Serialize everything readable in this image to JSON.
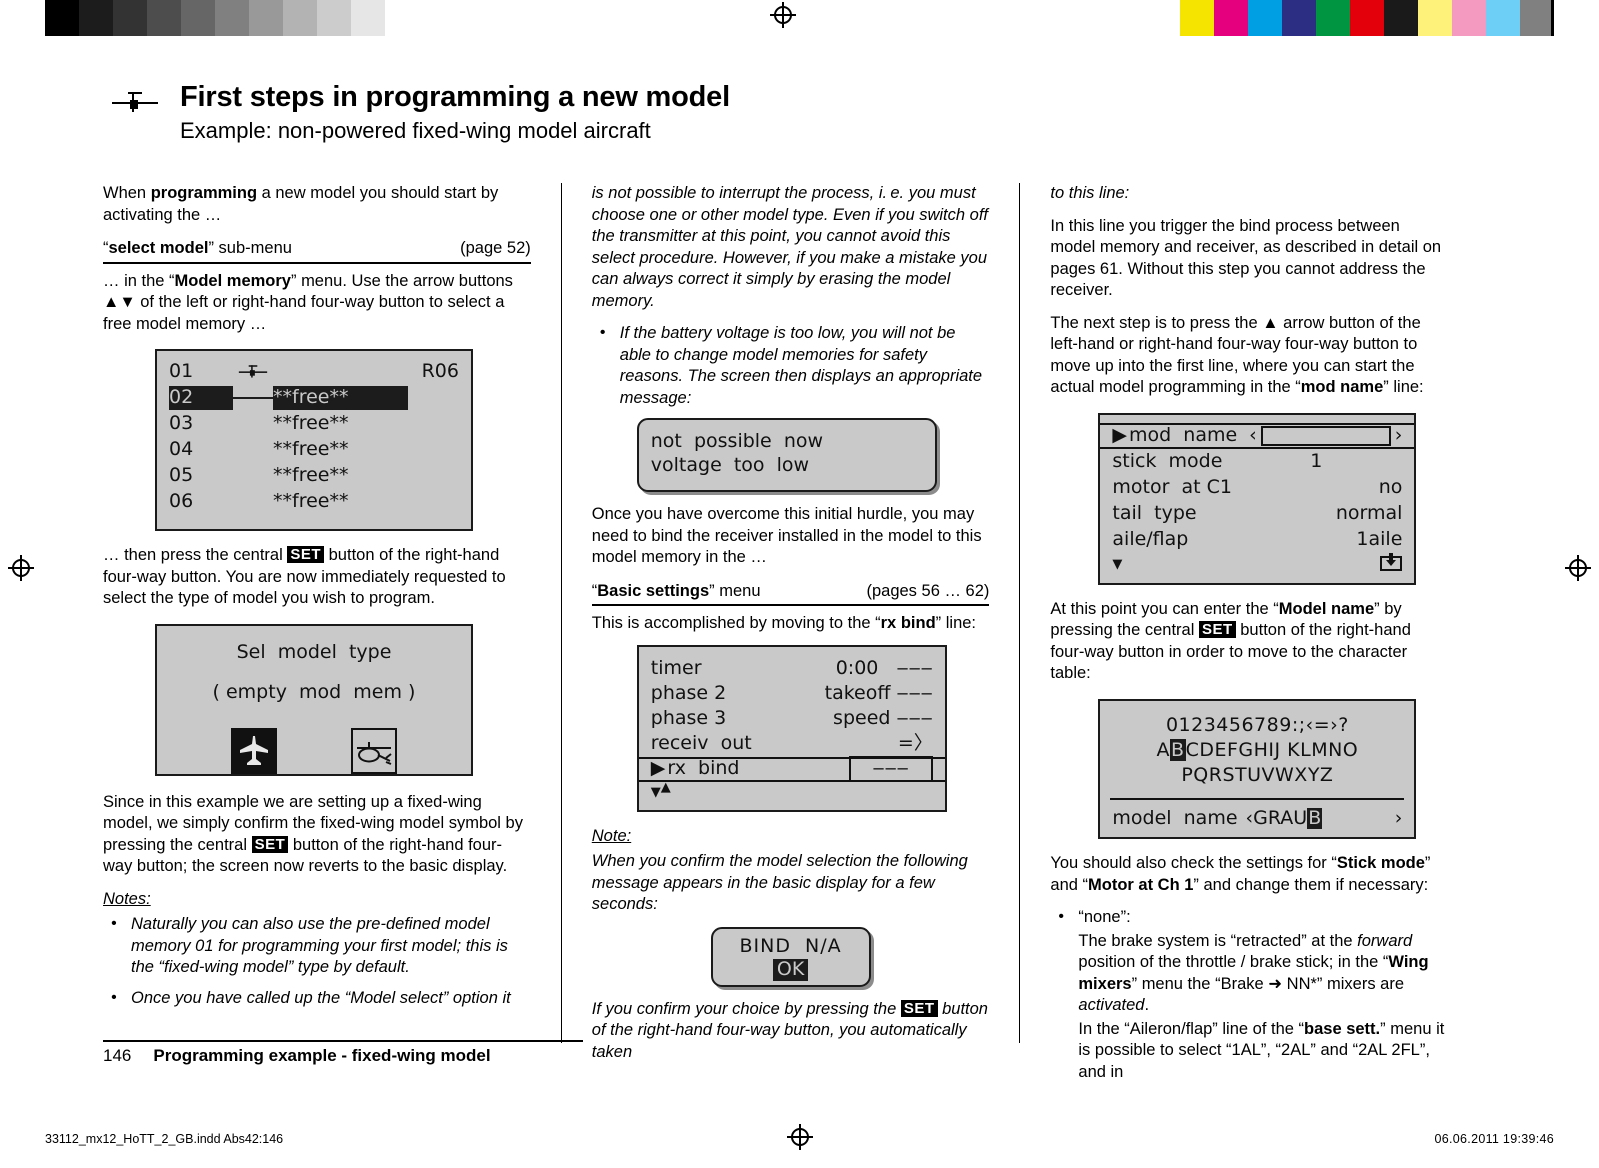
{
  "header": {
    "title": "First steps in programming a new model",
    "subtitle": "Example: non-powered fixed-wing model aircraft",
    "icon": "fixed-wing-model-icon"
  },
  "col1": {
    "intro_pre": "When ",
    "intro_bold": "programming",
    "intro_post": " a new model you should start by activating the …",
    "rule_head": {
      "quote_open": "“",
      "bold": "select model",
      "quote_close": "”",
      "rest": " sub-menu",
      "page_ref": "(page 52)"
    },
    "after_rule_1": "… in the “",
    "after_rule_bold": "Model memory",
    "after_rule_2": "” menu. Use the arrow buttons ▲▼ of the left or right-hand four-way button to select a free model memory …",
    "lcd_model_memory": {
      "name": "model-memory-list-display",
      "header_num": "01",
      "header_icon": "fixed-wing-model-icon",
      "header_right": "R06",
      "rows": [
        {
          "num": "02",
          "label": "**free**",
          "selected": true
        },
        {
          "num": "03",
          "label": "**free**",
          "selected": false
        },
        {
          "num": "04",
          "label": "**free**",
          "selected": false
        },
        {
          "num": "05",
          "label": "**free**",
          "selected": false
        },
        {
          "num": "06",
          "label": "**free**",
          "selected": false
        }
      ]
    },
    "after_lcd1_a": "… then press the central ",
    "set_key": "SET",
    "after_lcd1_b": " button of the right-hand four-way button. You are now immediately requested to select the type of model you wish to program.",
    "lcd_sel_model": {
      "name": "select-model-type-display",
      "line1": "Sel  model  type",
      "line2": "( empty  mod  mem )",
      "icon_fixed_wing": "fixed-wing-model-icon",
      "icon_heli": "helicopter-model-icon"
    },
    "after_lcd2_a": "Since in this example we are setting up a fixed-wing model, we simply confirm the fixed-wing model symbol by pressing the central ",
    "after_lcd2_b": " button of the right-hand four-way button; the screen now reverts to the basic display.",
    "notes_label": "Notes:",
    "notes": [
      "Naturally you can also use the pre-defined model memory 01 for programming your first model; this is the “fixed-wing model” type by default.",
      "Once you have called up the “Model select” option it"
    ]
  },
  "col2": {
    "cont_italic": "is not possible to interrupt the process, i. e. you must choose one or other model type. Even if you switch off the transmitter at this point, you cannot avoid this select procedure. However, if you make a mistake you can always correct it simply by erasing the model memory.",
    "bullet_italic": "If the battery voltage is too low, you will not be able to change model memories for safety reasons. The screen then displays an appropriate message:",
    "lcd_not_possible": {
      "name": "voltage-warning-display",
      "line1": "not  possible  now",
      "line2": "voltage  too  low"
    },
    "after_msg": "Once you have overcome this initial hurdle, you may need to bind the receiver installed in the model to this model memory in the …",
    "rule_head": {
      "quote_open": "“",
      "bold": "Basic settings",
      "quote_close": "”",
      "rest": " menu",
      "page_ref": "(pages 56 … 62)"
    },
    "after_rule_a": "This is accomplished by moving to the “",
    "after_rule_bold": "rx bind",
    "after_rule_b": "” line:",
    "lcd_basic_settings": {
      "name": "basic-settings-rx-bind-display",
      "rows": [
        {
          "label": "timer",
          "value": "0:00   ‒‒‒",
          "selected": false
        },
        {
          "label": "phase 2",
          "value": "takeoff ‒‒‒",
          "selected": false
        },
        {
          "label": "phase 3",
          "value": "speed ‒‒‒",
          "selected": false
        },
        {
          "label": "receiv  out",
          "value": "=〉",
          "selected": false
        },
        {
          "label": "rx  bind",
          "value": "‒‒‒",
          "selected": true
        }
      ],
      "scroll_down": "▼",
      "scroll_up": "▲"
    },
    "note_label": "Note:",
    "note_text": "When you confirm the model selection the following message appears in the basic display for a few seconds:",
    "lcd_bind_na": {
      "name": "bind-na-display",
      "line1": "BIND  N/A",
      "line2": "OK"
    },
    "tail_a": "If you confirm your choice by pressing the ",
    "set_key": "SET",
    "tail_b": " button of the right-hand four-way button, you automatically taken"
  },
  "col3": {
    "lead_italic": "to this line:",
    "para1": "In this line you trigger the bind process between model memory and receiver, as described in detail on pages 61. Without this step you cannot address the receiver.",
    "para2_a": "The next step is to press the ▲ arrow button of the left-hand or right-hand four-way four-way button to move up into the first line, where you can start the actual model programming in the “",
    "para2_bold": "mod name",
    "para2_b": "” line:",
    "lcd_mod_name": {
      "name": "model-base-settings-display",
      "rows": [
        {
          "label": "mod  name",
          "value": "",
          "selected": true,
          "field": true
        },
        {
          "label": "stick  mode",
          "value": "1",
          "selected": false,
          "field": false
        },
        {
          "label": "motor  at C1",
          "value": "no",
          "selected": false,
          "field": false
        },
        {
          "label": "tail  type",
          "value": "normal",
          "selected": false,
          "field": false
        },
        {
          "label": "aile/flap",
          "value": "1aile",
          "selected": false,
          "field": false
        }
      ],
      "scroll_down": "▼",
      "page_icon": "store-page-icon"
    },
    "para3_a": "At this point you can enter the “",
    "para3_bold": "Model name",
    "para3_b": "” by pressing the central ",
    "set_key": "SET",
    "para3_c": " button of the right-hand four-way button in order to move to the character table:",
    "lcd_char_table": {
      "name": "character-table-display",
      "row1": "0123456789:;‹=›?",
      "row2_pre": "A",
      "row2_sel": "B",
      "row2_post": "CDEFGHIJ KLMNO",
      "row3": "PQRSTUVWXYZ",
      "name_label": "model  name",
      "name_open": "‹",
      "name_value": "GRAU",
      "name_cursor": "B",
      "name_close": "›"
    },
    "para4_a": "You should also check the settings for “",
    "para4_bold1": "Stick mode",
    "para4_b": "” and “",
    "para4_bold2": "Motor at Ch 1",
    "para4_c": "” and change them if necessary:",
    "bullet_title": "“none”:",
    "bullet_p1_a": "The brake system is “retracted” at the ",
    "bullet_p1_ital": "forward",
    "bullet_p1_b": " position of the throttle / brake stick; in the “",
    "bullet_p1_bold": "Wing mixers",
    "bullet_p1_c": "” menu the “Brake ➜ NN*” mixers are ",
    "bullet_p1_ital2": "activated",
    "bullet_p1_d": ".",
    "bullet_p2_a": "In the “Aileron/flap” line of the “",
    "bullet_p2_bold": "base sett.",
    "bullet_p2_b": "” menu it is possible to select “1AL”, “2AL” and “2AL  2FL”, and in"
  },
  "footer": {
    "page_number": "146",
    "section": "Programming example - fixed-wing model"
  },
  "imprint": {
    "left": "33112_mx12_HoTT_2_GB.indd   Abs42:146",
    "right": "06.06.2011   19:39:46"
  },
  "colors": {
    "lcd_background": "#c9c9c9",
    "lcd_ink": "#111111",
    "page_background": "#ffffff"
  }
}
